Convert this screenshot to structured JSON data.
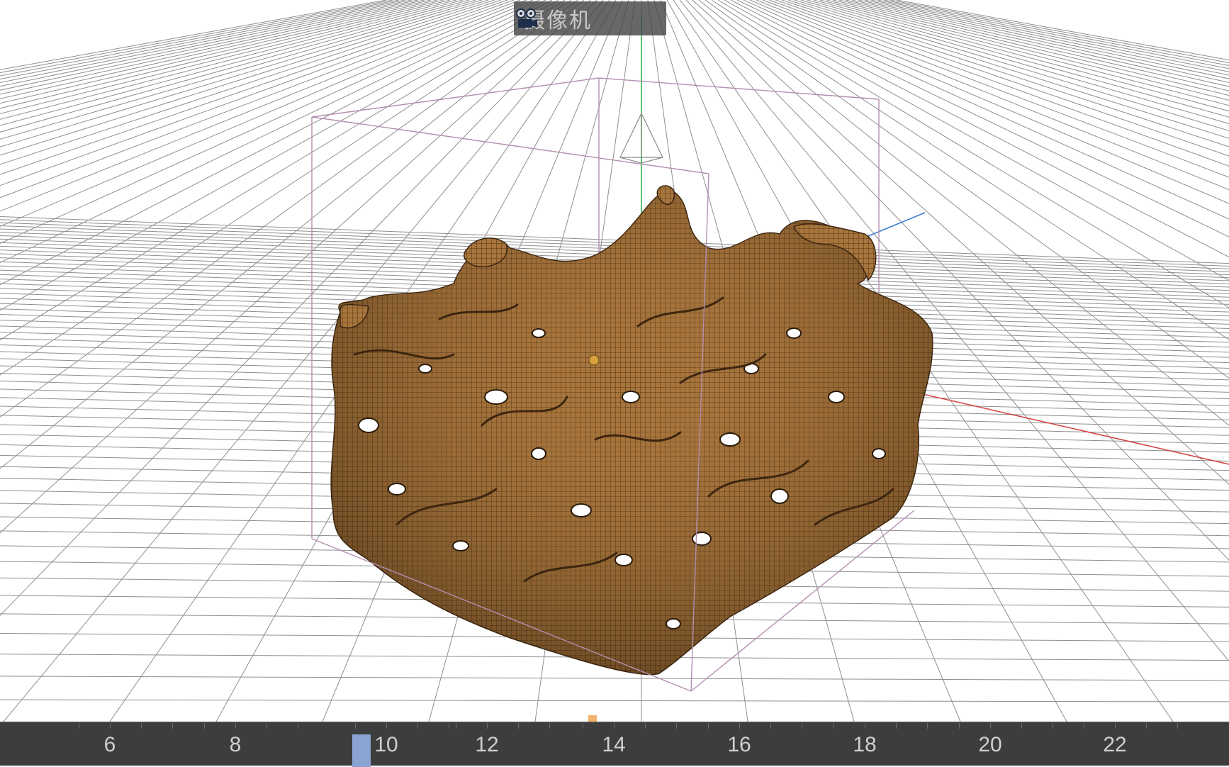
{
  "viewport": {
    "camera_label": "摄像机",
    "camera_icon": "camera-icon",
    "object": "porous-mesh-object",
    "colors": {
      "grid": "#9a9a9a",
      "bounding_box": "#b48fb0",
      "mesh": "#9a6a35",
      "x_axis": "#d24a4a",
      "y_axis": "#2fb34a",
      "z_axis": "#3a7bd5"
    }
  },
  "timeline": {
    "current_frame_label": "10",
    "ticks": [
      "6",
      "8",
      "10",
      "12",
      "14",
      "16",
      "18",
      "20",
      "22"
    ],
    "colors": {
      "background": "#3d3d3d",
      "playhead": "#8aa3d0"
    }
  }
}
